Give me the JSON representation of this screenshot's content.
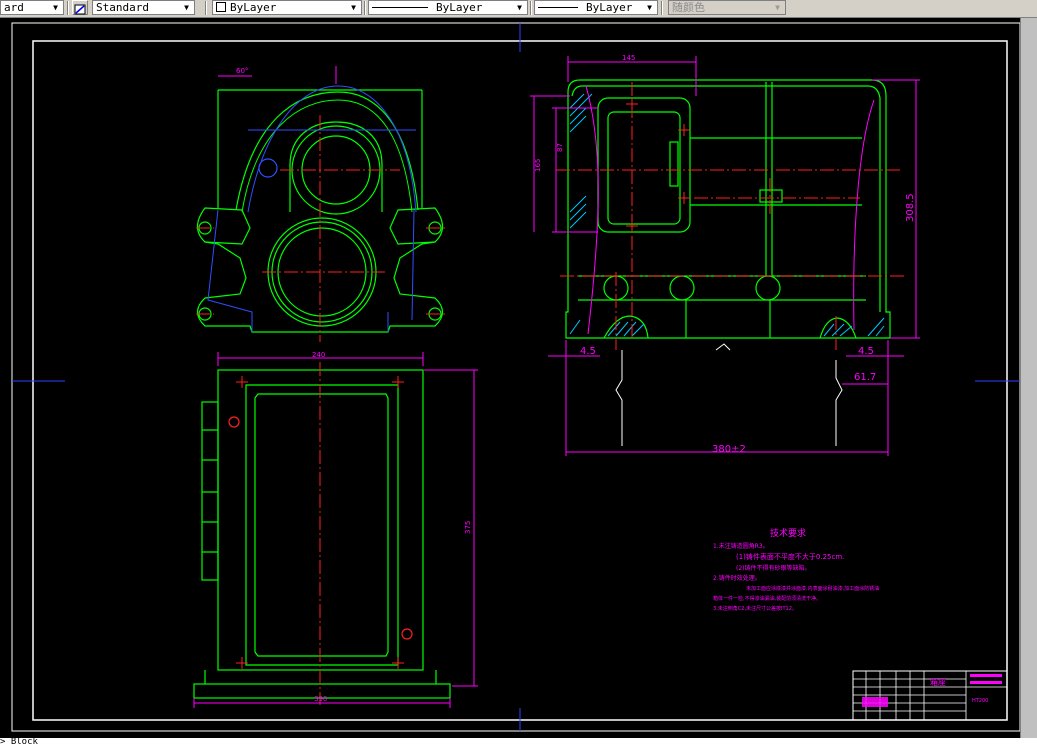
{
  "toolbar": {
    "style_value": "ard",
    "dimstyle_value": "Standard",
    "layer_value": "ByLayer",
    "linetype_value": "ByLayer",
    "lineweight_value": "ByLayer",
    "plotstyle_value": "随颜色"
  },
  "drawing": {
    "front_view": {
      "top_dim": "60°"
    },
    "plan_view": {
      "top_dim": "240",
      "right_dim": "375",
      "bottom_dim": "390"
    },
    "side_view": {
      "top_dim": "145",
      "left_dim_inner": "87",
      "left_dim_outer": "165",
      "right_dim": "308.5",
      "left_bottom_dim": "4.5",
      "right_bottom_dim": "4.5",
      "side_dim": "61.7",
      "bottom_dim": "380±2"
    },
    "notes": {
      "title": "技术要求",
      "lines": [
        "1.未注铸造圆角R3。",
        "(1)铸件表面不平度不大于0.25cm.",
        "(2)铸件不得有砂眼等缺陷。",
        "2.铸件时效处理。",
        "未加工面应涂底漆并涂面漆,内表面涂耐油漆,加工面涂防锈油",
        "箱体一件一检,不得渗油漏油,装配前须清洗干净。",
        "3.未注倒角C2,未注尺寸公差按IT12。"
      ]
    },
    "title_block": {
      "part_name": "箱座",
      "material": "HT200"
    }
  },
  "command_line": {
    "text": "> Block"
  }
}
